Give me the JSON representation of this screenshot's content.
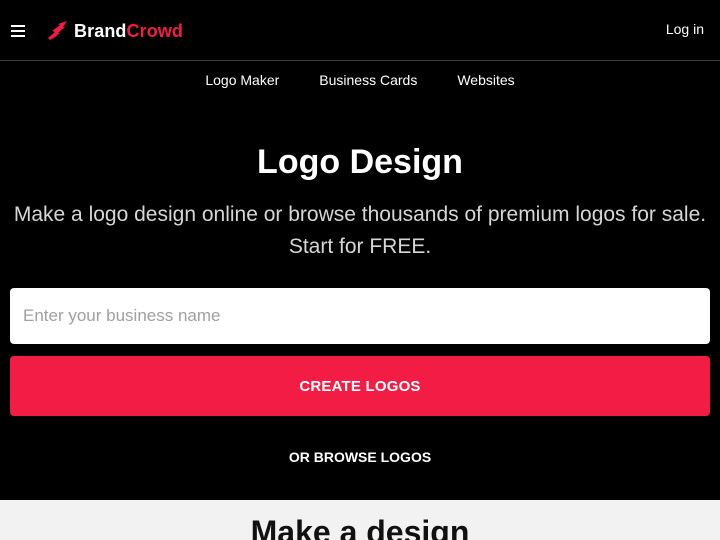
{
  "header": {
    "brand_part1": "Brand",
    "brand_part2": "Crowd",
    "login_label": "Log in",
    "menu_icon": "hamburger-icon",
    "logo_icon": "brandcrowd-bird-icon",
    "accent_color": "#f31c45"
  },
  "subnav": {
    "items": [
      {
        "label": "Logo Maker"
      },
      {
        "label": "Business Cards"
      },
      {
        "label": "Websites"
      }
    ]
  },
  "hero": {
    "title": "Logo Design",
    "subtitle": "Make a logo design online or browse thousands of premium logos for sale. Start for FREE.",
    "input_placeholder": "Enter your business name",
    "input_value": "",
    "cta_label": "CREATE LOGOS",
    "browse_label": "OR BROWSE LOGOS"
  },
  "section": {
    "title": "Make a design"
  }
}
